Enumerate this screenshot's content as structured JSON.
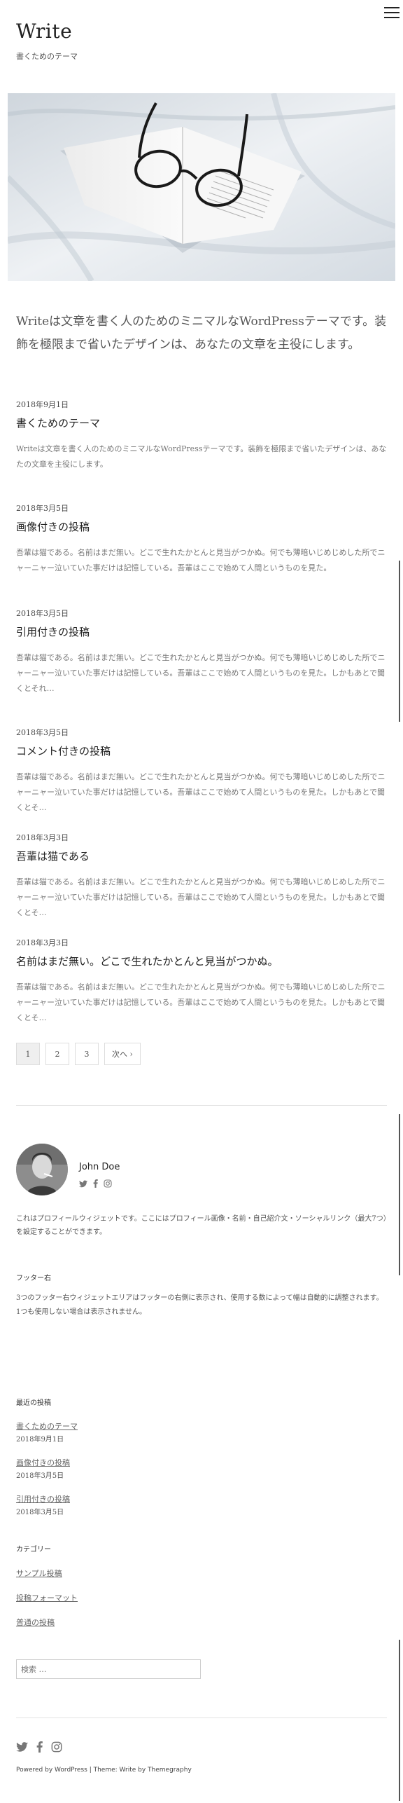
{
  "site": {
    "title": "Write",
    "description": "書くためのテーマ"
  },
  "hero": {
    "image": "book-with-glasses-photo"
  },
  "intro": "Writeは文章を書く人のためのミニマルなWordPressテーマです。装飾を極限まで省いたデザインは、あなたの文章を主役にします。",
  "posts": [
    {
      "date": "2018年9月1日",
      "title": "書くためのテーマ",
      "excerpt": "Writeは文章を書く人のためのミニマルなWordPressテーマです。装飾を極限まで省いたデザインは、あなたの文章を主役にします。"
    },
    {
      "date": "2018年3月5日",
      "title": "画像付きの投稿",
      "excerpt": "吾輩は猫である。名前はまだ無い。どこで生れたかとんと見当がつかぬ。何でも薄暗いじめじめした所でニャーニャー泣いていた事だけは記憶している。吾輩はここで始めて人間というものを見た。"
    },
    {
      "date": "2018年3月5日",
      "title": "引用付きの投稿",
      "excerpt": "吾輩は猫である。名前はまだ無い。どこで生れたかとんと見当がつかぬ。何でも薄暗いじめじめした所でニャーニャー泣いていた事だけは記憶している。吾輩はここで始めて人間というものを見た。しかもあとで聞くとそれ…"
    },
    {
      "date": "2018年3月5日",
      "title": "コメント付きの投稿",
      "excerpt": "吾輩は猫である。名前はまだ無い。どこで生れたかとんと見当がつかぬ。何でも薄暗いじめじめした所でニャーニャー泣いていた事だけは記憶している。吾輩はここで始めて人間というものを見た。しかもあとで聞くとそ…"
    },
    {
      "date": "2018年3月3日",
      "title": "吾輩は猫である",
      "excerpt": "吾輩は猫である。名前はまだ無い。どこで生れたかとんと見当がつかぬ。何でも薄暗いじめじめした所でニャーニャー泣いていた事だけは記憶している。吾輩はここで始めて人間というものを見た。しかもあとで聞くとそ…"
    },
    {
      "date": "2018年3月3日",
      "title": "名前はまだ無い。どこで生れたかとんと見当がつかぬ。",
      "excerpt": "吾輩は猫である。名前はまだ無い。どこで生れたかとんと見当がつかぬ。何でも薄暗いじめじめした所でニャーニャー泣いていた事だけは記憶している。吾輩はここで始めて人間というものを見た。しかもあとで聞くとそ…"
    }
  ],
  "pagination": {
    "pages": [
      "1",
      "2",
      "3"
    ],
    "current": "1",
    "next": "次へ ›"
  },
  "profile": {
    "name": "John Doe",
    "social_icons": [
      "twitter-icon",
      "facebook-icon",
      "instagram-icon"
    ],
    "text": "これはプロフィールウィジェットです。ここにはプロフィール画像・名前・自己紹介文・ソーシャルリンク（最大7つ）を設定することができます。"
  },
  "footer_right": {
    "title": "フッター右",
    "text": "3つのフッター右ウィジェットエリアはフッターの右側に表示され、使用する数によって幅は自動的に調整されます。1つも使用しない場合は表示されません。"
  },
  "recent_posts": {
    "title": "最近の投稿",
    "items": [
      {
        "title": "書くためのテーマ",
        "date": "2018年9月1日"
      },
      {
        "title": "画像付きの投稿",
        "date": "2018年3月5日"
      },
      {
        "title": "引用付きの投稿",
        "date": "2018年3月5日"
      }
    ]
  },
  "categories": {
    "title": "カテゴリー",
    "items": [
      "サンプル投稿",
      "投稿フォーマット",
      "普通の投稿"
    ]
  },
  "search": {
    "placeholder": "検索 …"
  },
  "footer": {
    "social_icons": [
      "twitter-icon",
      "facebook-icon",
      "instagram-icon"
    ],
    "powered": "Powered by WordPress | Theme: Write by Themegraphy"
  },
  "colors": {
    "text": "#333333",
    "muted": "#777777",
    "border": "#dddddd",
    "background": "#ffffff"
  }
}
